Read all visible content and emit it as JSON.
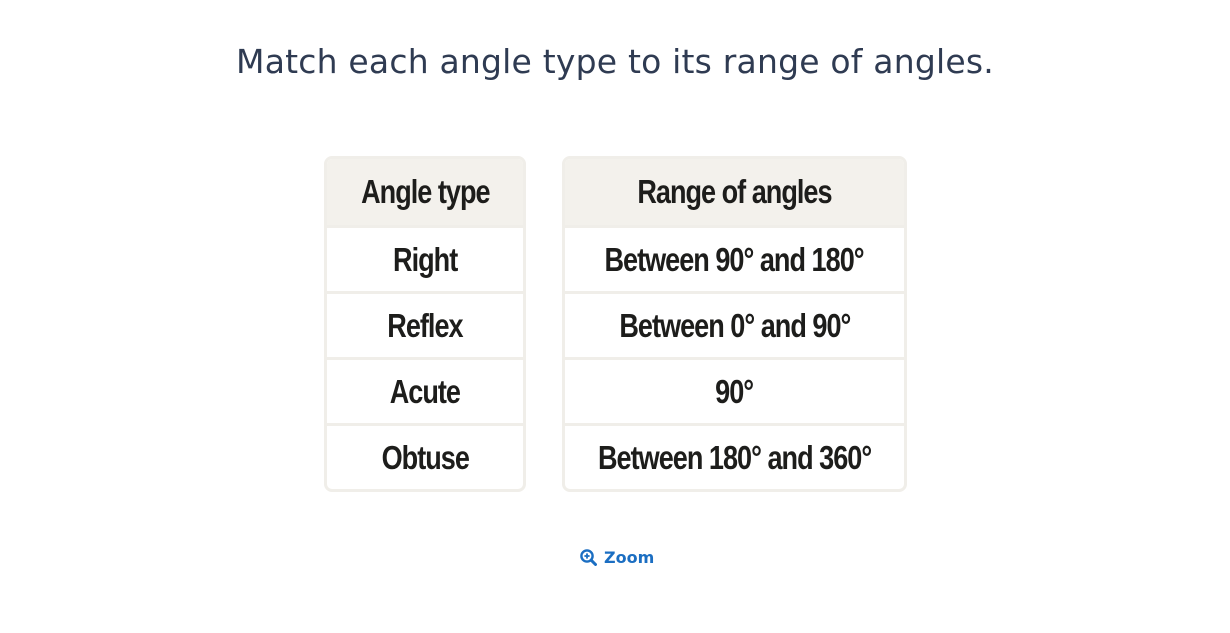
{
  "prompt": "Match each angle type to its range of angles.",
  "table": {
    "left_header": "Angle type",
    "right_header": "Range of angles",
    "angle_types": [
      "Right",
      "Reflex",
      "Acute",
      "Obtuse"
    ],
    "ranges": [
      "Between 90° and 180°",
      "Between 0° and 90°",
      "90°",
      "Between 180° and 360°"
    ]
  },
  "zoom": {
    "label": "Zoom",
    "icon": "zoom-in-icon",
    "color": "#1b6ec2"
  },
  "colors": {
    "prompt_text": "#2f3b52",
    "header_bg": "#f3f1ec",
    "border": "#f0eee9"
  }
}
